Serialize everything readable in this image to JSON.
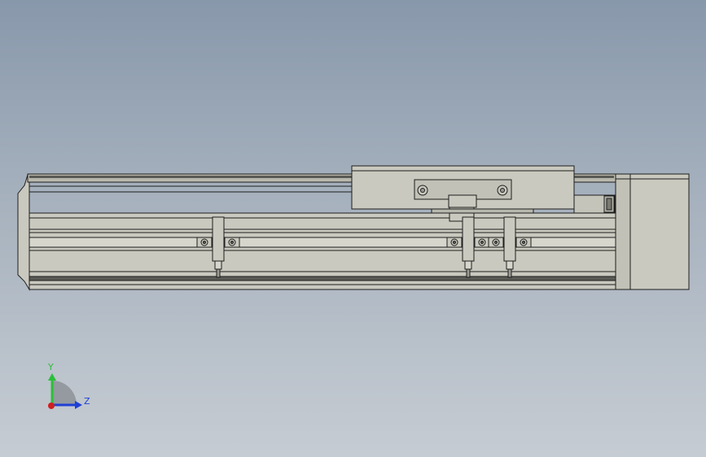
{
  "viewport": {
    "background_top": "#8898ab",
    "background_bottom": "#c6ccd3"
  },
  "model": {
    "body_color": "#c9c9bf",
    "edge_color": "#1e1e1e",
    "shade_color": "#a9a9a0",
    "dark_slot_color": "#5a5a55"
  },
  "triad": {
    "y_label": "Y",
    "z_label": "Z",
    "y_color": "#2bbf3a",
    "z_color": "#1f3fd6",
    "x_color": "#d11f1f"
  }
}
